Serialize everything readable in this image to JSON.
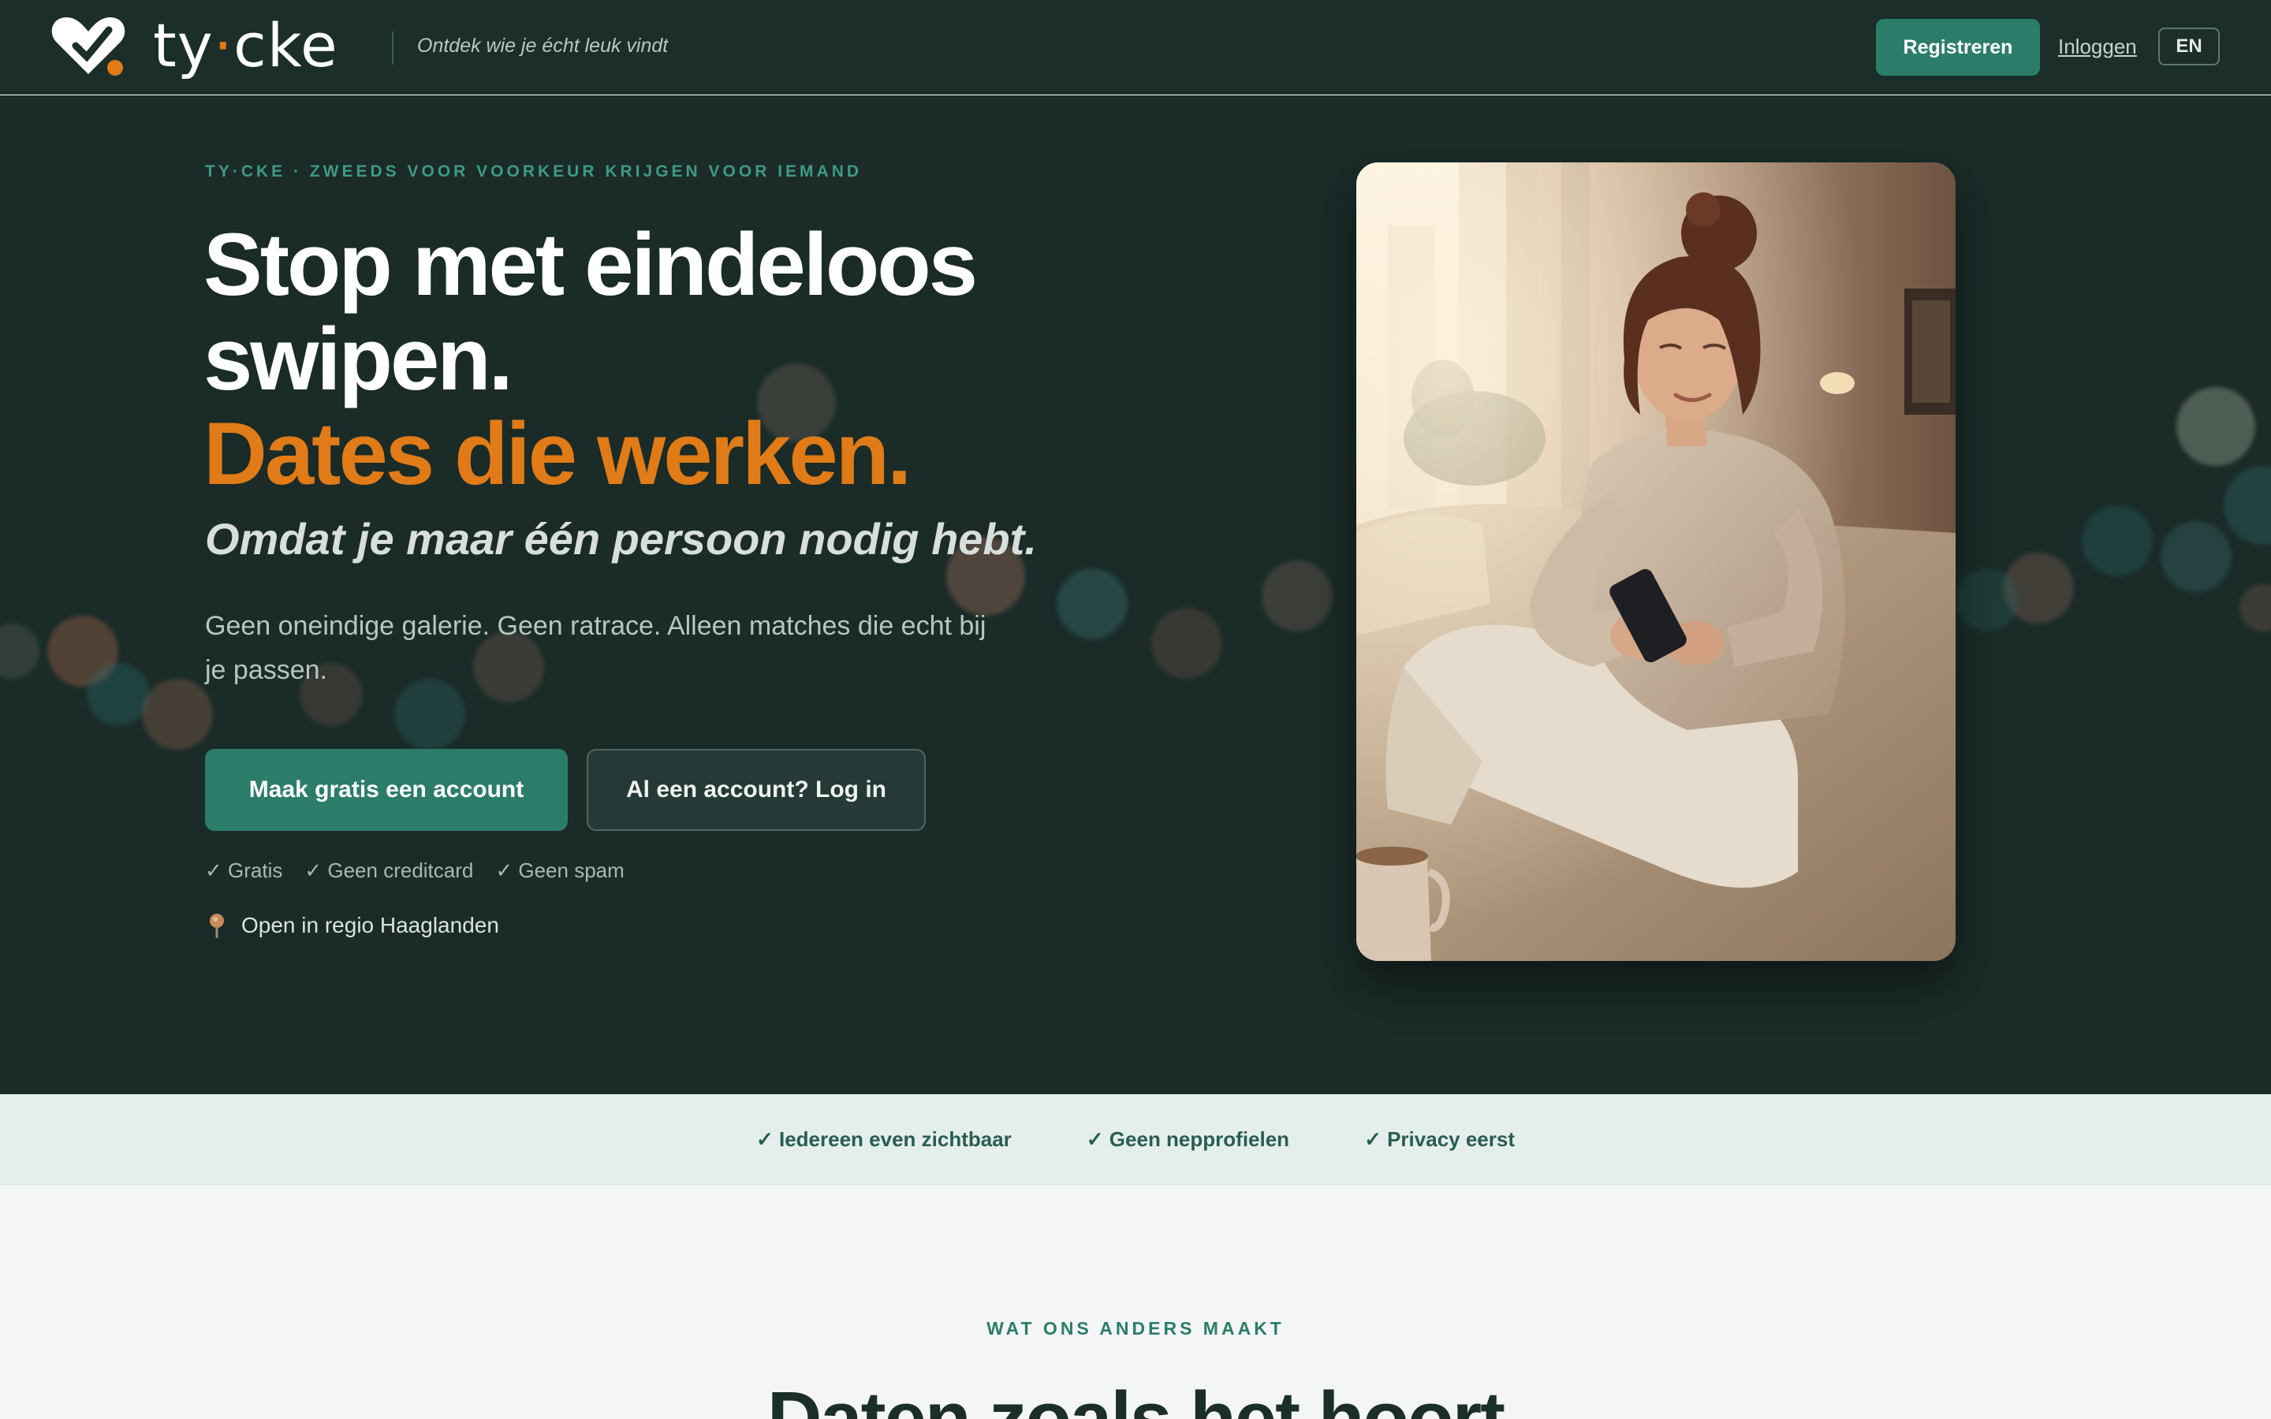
{
  "header": {
    "logo_text_a": "ty",
    "logo_dot": "·",
    "logo_text_b": "cke",
    "tagline": "Ontdek wie je écht leuk vindt",
    "register_label": "Registreren",
    "login_label": "Inloggen",
    "language_label": "EN"
  },
  "hero": {
    "eyebrow": "TY·CKE · ZWEEDS VOOR VOORKEUR KRIJGEN VOOR IEMAND",
    "headline_line1": "Stop met eindeloos",
    "headline_line2": "swipen.",
    "headline_accent": "Dates die werken.",
    "subheadline": "Omdat je maar één persoon nodig hebt.",
    "body": "Geen oneindige galerie. Geen ratrace. Alleen matches die echt bij je passen.",
    "primary_cta": "Maak gratis een account",
    "secondary_cta": "Al een account? Log in",
    "checks": [
      "✓ Gratis",
      "✓ Geen creditcard",
      "✓ Geen spam"
    ],
    "region": "Open in regio Haaglanden"
  },
  "trust_bar": {
    "items": [
      "✓ Iedereen even zichtbaar",
      "✓ Geen nepprofielen",
      "✓ Privacy eerst"
    ]
  },
  "section": {
    "eyebrow": "WAT ONS ANDERS MAAKT",
    "title": "Daten zoals het hoort"
  },
  "colors": {
    "header_bg": "#1b2e2a",
    "hero_bg": "#1a2b28",
    "brand_green": "#2b7d6a",
    "accent_orange": "#e07b17",
    "trust_bg": "#e4efec"
  },
  "icons": {
    "logo": "heart-logo-icon",
    "region": "map-pin-icon"
  }
}
